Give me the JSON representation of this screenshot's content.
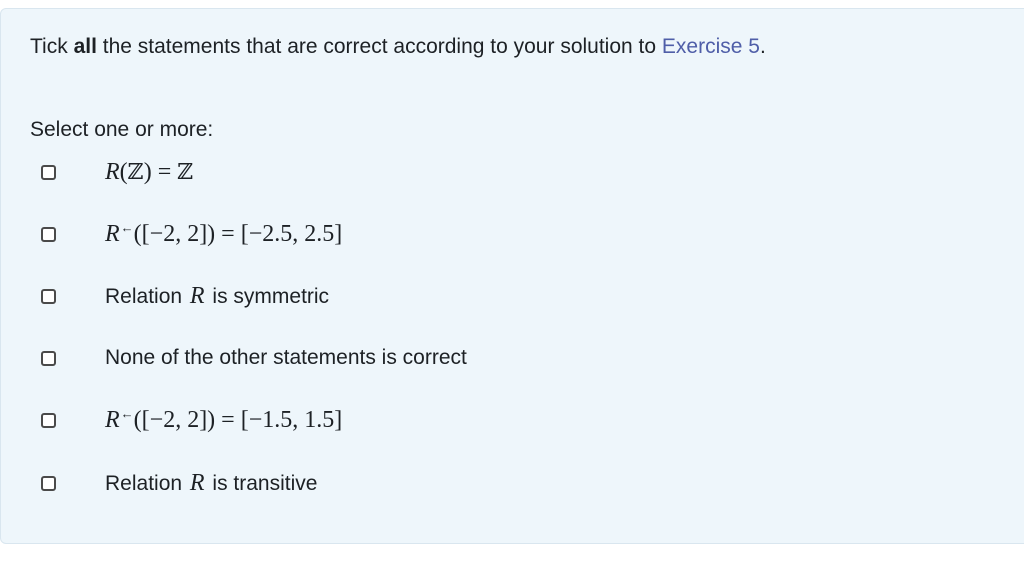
{
  "question": {
    "text_before": "Tick ",
    "text_bold": "all",
    "text_after": " the statements that are correct according to your solution to ",
    "link_text": "Exercise 5",
    "text_end": "."
  },
  "prompt": "Select one or more:",
  "options": [
    {
      "checked": false,
      "R": "R",
      "open": "(",
      "Z1": "ℤ",
      "close": ")",
      "eq": " = ",
      "Z2": "ℤ"
    },
    {
      "checked": false,
      "R": "R",
      "arrow": "←",
      "expr": "([−2, 2]) = [−2.5, 2.5]"
    },
    {
      "checked": false,
      "pre": "Relation ",
      "R": "R",
      "post": " is symmetric"
    },
    {
      "checked": false,
      "text": "None of the other statements is correct"
    },
    {
      "checked": false,
      "R": "R",
      "arrow": "←",
      "expr": "([−2, 2]) = [−1.5, 1.5]"
    },
    {
      "checked": false,
      "pre": "Relation ",
      "R": "R",
      "post": " is transitive"
    }
  ]
}
